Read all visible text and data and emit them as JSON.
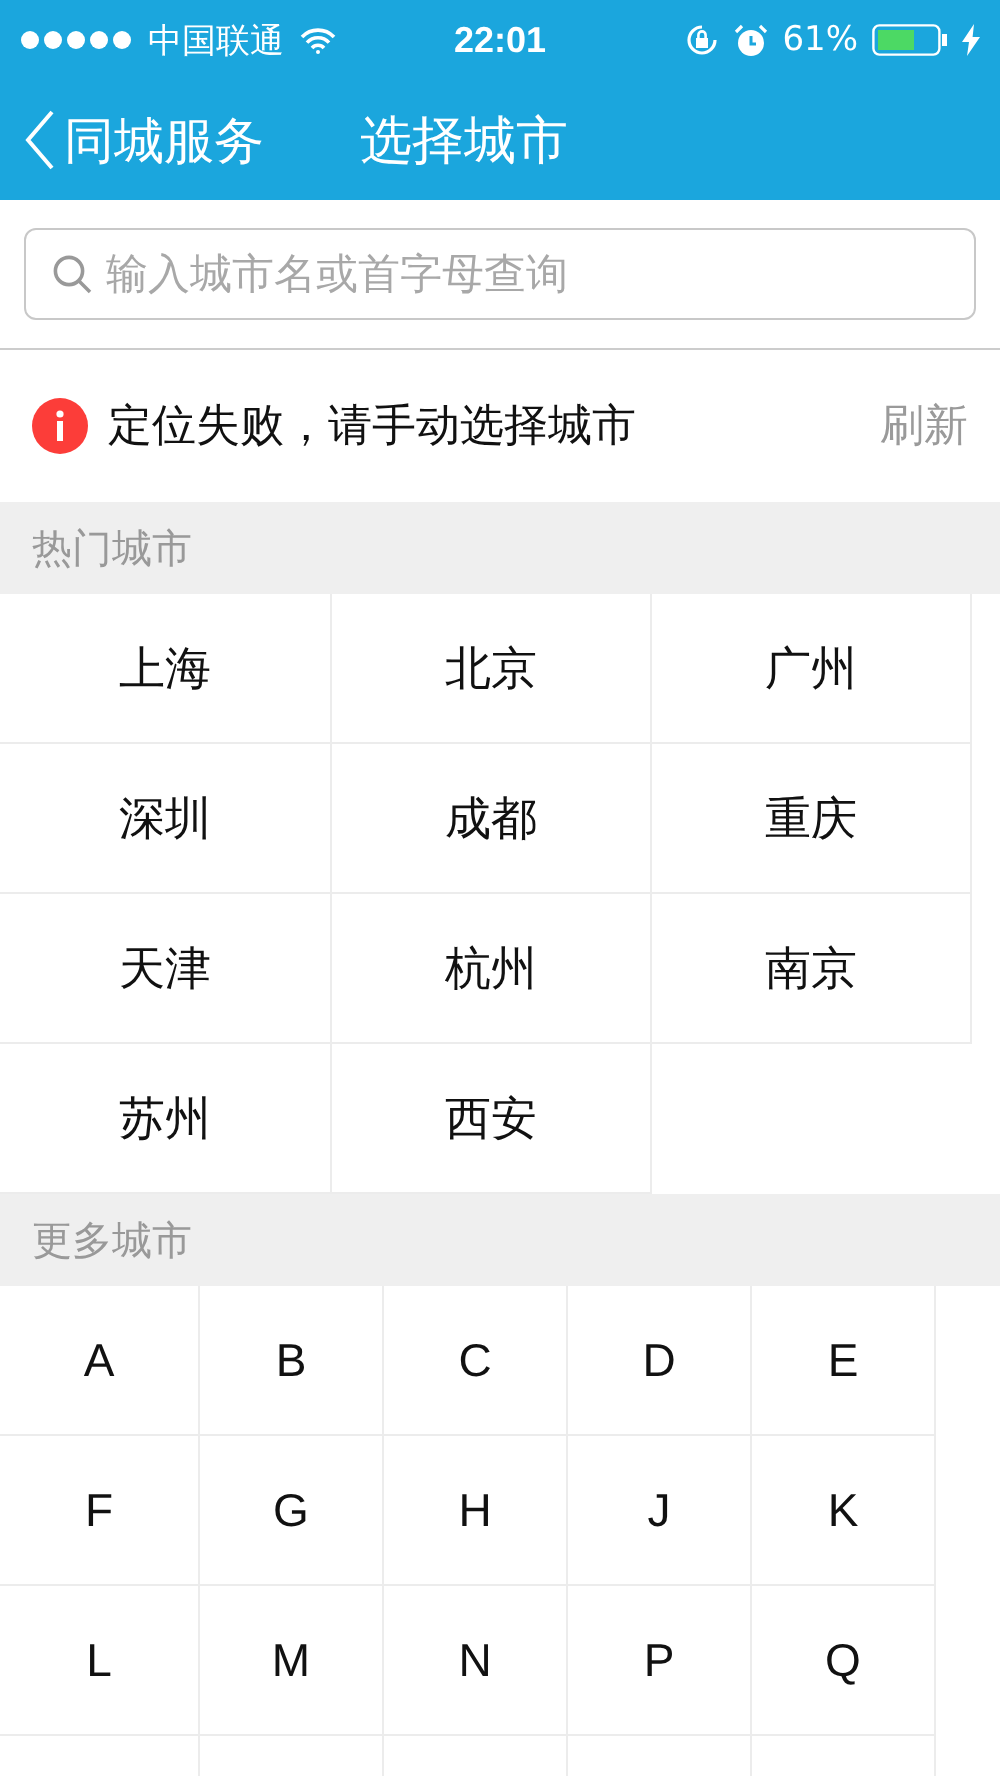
{
  "status_bar": {
    "carrier": "中国联通",
    "time": "22:01",
    "battery": "61%"
  },
  "nav": {
    "back": "同城服务",
    "title": "选择城市"
  },
  "search": {
    "placeholder": "输入城市名或首字母查询"
  },
  "location": {
    "message": "定位失败，请手动选择城市",
    "action": "刷新"
  },
  "hot_section": {
    "title": "热门城市",
    "cities": [
      "上海",
      "北京",
      "广州",
      "深圳",
      "成都",
      "重庆",
      "天津",
      "杭州",
      "南京",
      "苏州",
      "西安"
    ]
  },
  "more_section": {
    "title": "更多城市",
    "letters": [
      "A",
      "B",
      "C",
      "D",
      "E",
      "F",
      "G",
      "H",
      "J",
      "K",
      "L",
      "M",
      "N",
      "P",
      "Q"
    ]
  }
}
